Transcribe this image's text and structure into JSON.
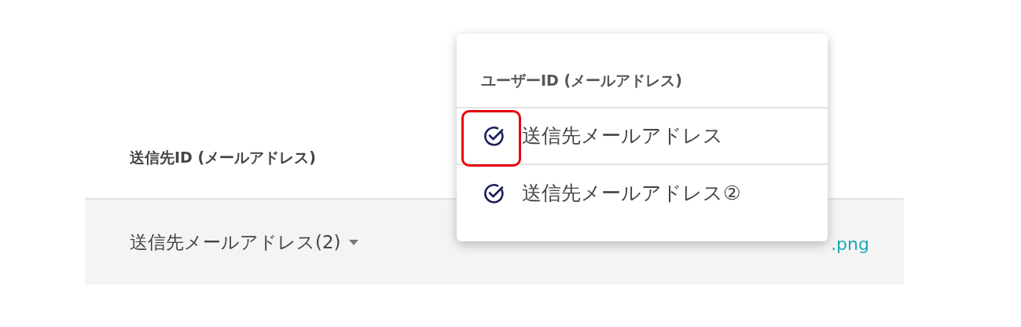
{
  "table": {
    "column_header": "送信先ID (メールアドレス)",
    "row": {
      "recipient": "送信先メールアドレス(2)",
      "file_link": ".png"
    }
  },
  "dropdown_menu": {
    "heading": "ユーザーID (メールアドレス)",
    "items": [
      {
        "label": "送信先メールアドレス",
        "checked": true,
        "highlighted": true
      },
      {
        "label": "送信先メールアドレス②",
        "checked": true,
        "highlighted": false
      }
    ]
  }
}
